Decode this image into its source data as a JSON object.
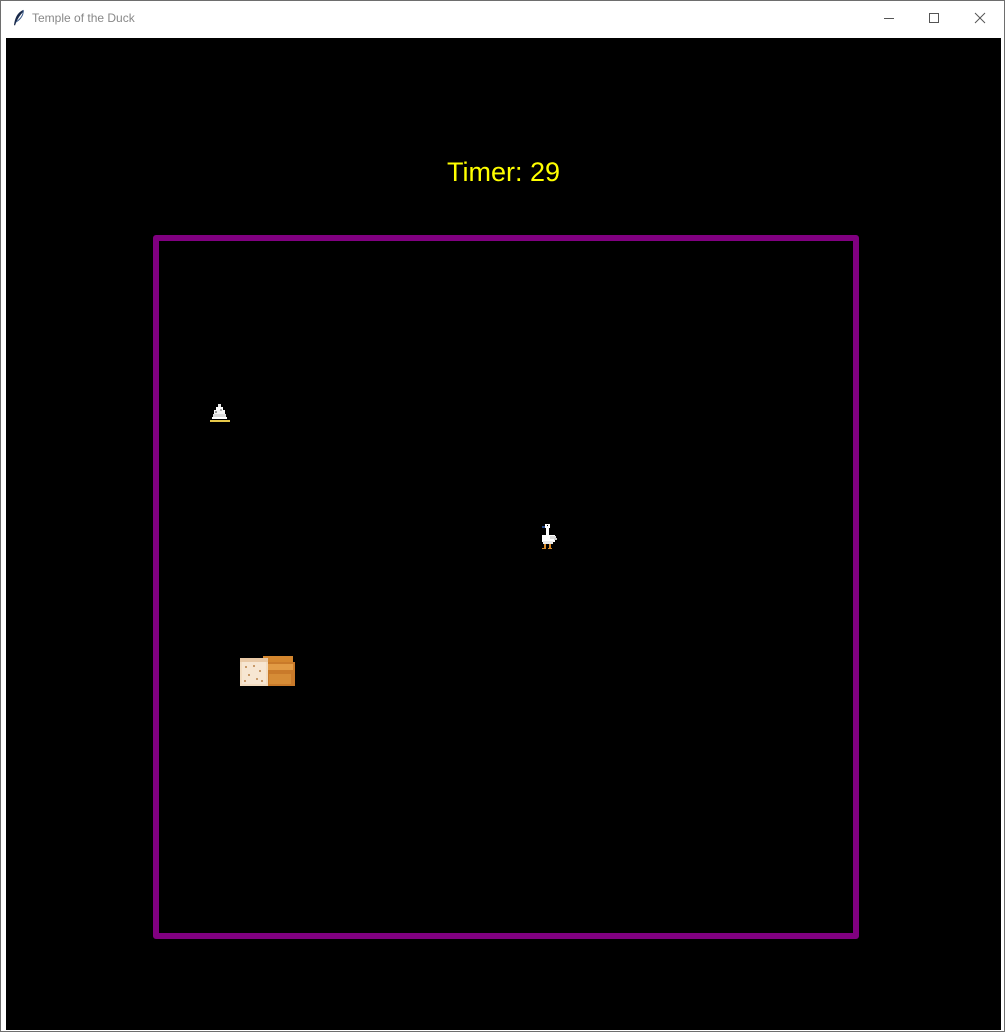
{
  "window": {
    "title": "Temple of the Duck",
    "icon": "feather-icon",
    "controls": [
      "minimize-icon",
      "maximize-icon",
      "close-icon"
    ]
  },
  "game": {
    "timer_text": "Timer: 29",
    "timer_value": 29,
    "colors": {
      "background": "#000000",
      "timer": "#ffff00",
      "arena_border": "#800080"
    },
    "sprites": [
      {
        "name": "player-duck",
        "icon": "duck-icon"
      },
      {
        "name": "bread-pickup",
        "icon": "bread-icon"
      },
      {
        "name": "cupcake-pickup",
        "icon": "cupcake-icon"
      }
    ]
  }
}
